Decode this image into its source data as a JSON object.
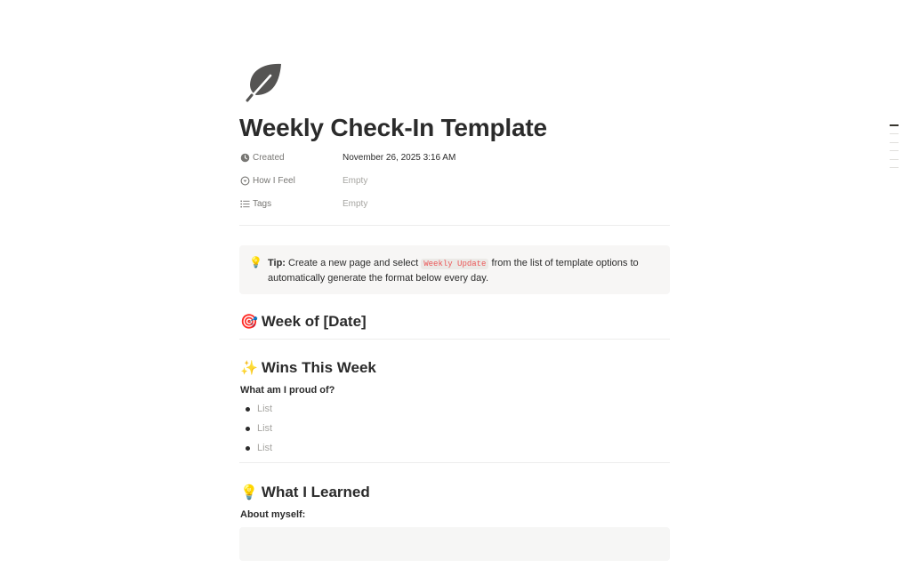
{
  "page": {
    "icon": "leaf-icon",
    "title": "Weekly Check-In Template"
  },
  "properties": [
    {
      "name": "Created",
      "icon": "clock-icon",
      "value": "November 26, 2025 3:16 AM"
    },
    {
      "name": "How I Feel",
      "icon": "select-icon",
      "value": "Empty"
    },
    {
      "name": "Tags",
      "icon": "list-icon",
      "value": "Empty"
    }
  ],
  "callout": {
    "icon": "💡",
    "label": "Tip:",
    "text_before": "Create a new page and select",
    "code": "Weekly Update",
    "text_after": "from the list of template options to automatically generate the format below every day."
  },
  "sections": {
    "week": {
      "emoji": "🎯",
      "heading": "Week of [Date]"
    },
    "wins": {
      "emoji": "✨",
      "heading": "Wins This Week",
      "question": "What am I proud of?",
      "items": [
        "List",
        "List",
        "List"
      ]
    },
    "learned": {
      "emoji": "💡",
      "heading": "What I Learned",
      "question": "About myself:"
    }
  },
  "colors": {
    "text": "#2b2b2b",
    "muted": "#787774",
    "placeholder": "#a6a5a1",
    "code_text": "#eb5757",
    "callout_bg": "#f7f6f5"
  }
}
